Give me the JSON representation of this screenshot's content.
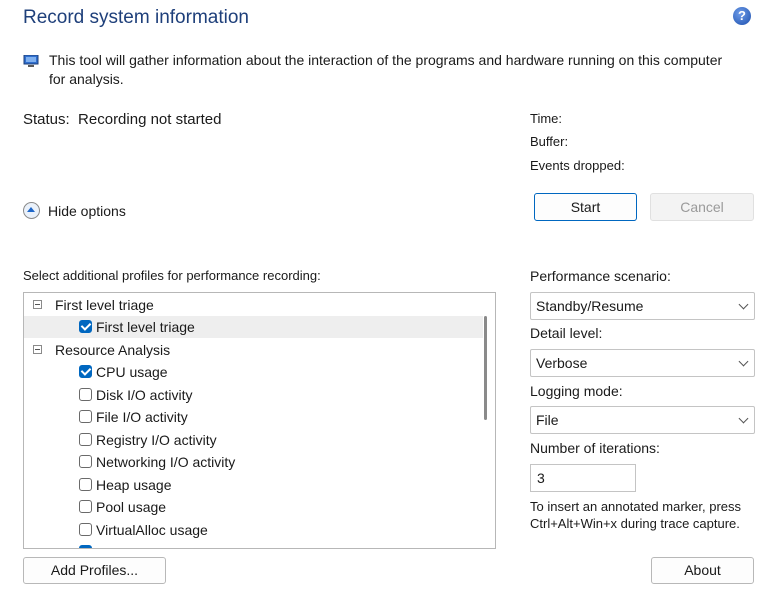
{
  "header": {
    "title": "Record system information",
    "help_icon": "help-icon",
    "help_symbol": "?"
  },
  "intro": {
    "icon": "computer-icon",
    "text": "This tool will gather information about the interaction of the programs and hardware running on this computer for analysis."
  },
  "status": {
    "label": "Status:",
    "value": "Recording not started"
  },
  "stats": {
    "time_label": "Time:",
    "buffer_label": "Buffer:",
    "events_label": "Events dropped:"
  },
  "actions": {
    "start_label": "Start",
    "cancel_label": "Cancel"
  },
  "options": {
    "hide_label": "Hide options"
  },
  "profiles": {
    "label": "Select additional profiles for performance recording:",
    "groups": [
      {
        "label": "First level triage",
        "items": [
          {
            "label": "First level triage",
            "checked": true
          }
        ]
      },
      {
        "label": "Resource Analysis",
        "items": [
          {
            "label": "CPU usage",
            "checked": true
          },
          {
            "label": "Disk I/O activity",
            "checked": false
          },
          {
            "label": "File I/O activity",
            "checked": false
          },
          {
            "label": "Registry I/O activity",
            "checked": false
          },
          {
            "label": "Networking I/O activity",
            "checked": false
          },
          {
            "label": "Heap usage",
            "checked": false
          },
          {
            "label": "Pool usage",
            "checked": false
          },
          {
            "label": "VirtualAlloc usage",
            "checked": false
          }
        ]
      }
    ]
  },
  "settings": {
    "scenario_label": "Performance scenario:",
    "scenario_value": "Standby/Resume",
    "detail_label": "Detail level:",
    "detail_value": "Verbose",
    "logging_label": "Logging mode:",
    "logging_value": "File",
    "iterations_label": "Number of iterations:",
    "iterations_value": "3",
    "marker_text": "To insert an annotated marker, press Ctrl+Alt+Win+x during trace capture."
  },
  "footer": {
    "add_profiles_label": "Add Profiles...",
    "about_label": "About"
  }
}
